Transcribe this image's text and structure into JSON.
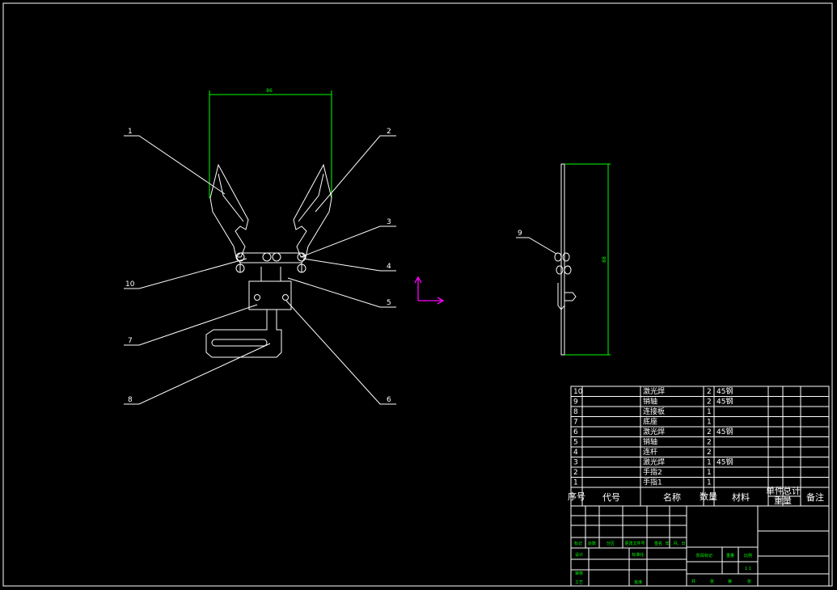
{
  "drawing": {
    "dimensions": {
      "width_label": "86",
      "height_label": "88"
    },
    "callouts": [
      "1",
      "2",
      "3",
      "4",
      "5",
      "6",
      "7",
      "8",
      "9",
      "10"
    ],
    "colors": {
      "background": "#000000",
      "outline": "#ffffff",
      "dimension": "#00ff00",
      "ucs_icon": "#ff00ff"
    }
  },
  "bom": {
    "rows": [
      {
        "no": "10",
        "name": "激光焊",
        "qty": "2",
        "material": "45钢"
      },
      {
        "no": "9",
        "name": "销轴",
        "qty": "2",
        "material": "45钢"
      },
      {
        "no": "8",
        "name": "连接板",
        "qty": "1",
        "material": ""
      },
      {
        "no": "7",
        "name": "底座",
        "qty": "1",
        "material": ""
      },
      {
        "no": "6",
        "name": "激光焊",
        "qty": "2",
        "material": "45钢"
      },
      {
        "no": "5",
        "name": "销轴",
        "qty": "2",
        "material": ""
      },
      {
        "no": "4",
        "name": "连杆",
        "qty": "2",
        "material": ""
      },
      {
        "no": "3",
        "name": "激光焊",
        "qty": "1",
        "material": "45钢"
      },
      {
        "no": "2",
        "name": "手指2",
        "qty": "1",
        "material": ""
      },
      {
        "no": "1",
        "name": "手指1",
        "qty": "1",
        "material": ""
      }
    ],
    "header": {
      "no": "序号",
      "code": "代号",
      "name": "名称",
      "qty": "数量",
      "material": "材料",
      "weight_single": "单件",
      "weight_total": "总计",
      "weight_label": "重量",
      "remarks": "备注"
    }
  },
  "title_block": {
    "change_row": [
      "标记",
      "处数",
      "分区",
      "更改文件号",
      "签名",
      "年、月、日"
    ],
    "design": "设计",
    "standardize": "标准化",
    "review": "审核",
    "process": "工艺",
    "approve": "批准",
    "stage_mark": "阶段标记",
    "weight": "重量",
    "scale": "比例",
    "scale_value": "1:1",
    "sheets": [
      "共",
      "张",
      "第",
      "张"
    ]
  }
}
